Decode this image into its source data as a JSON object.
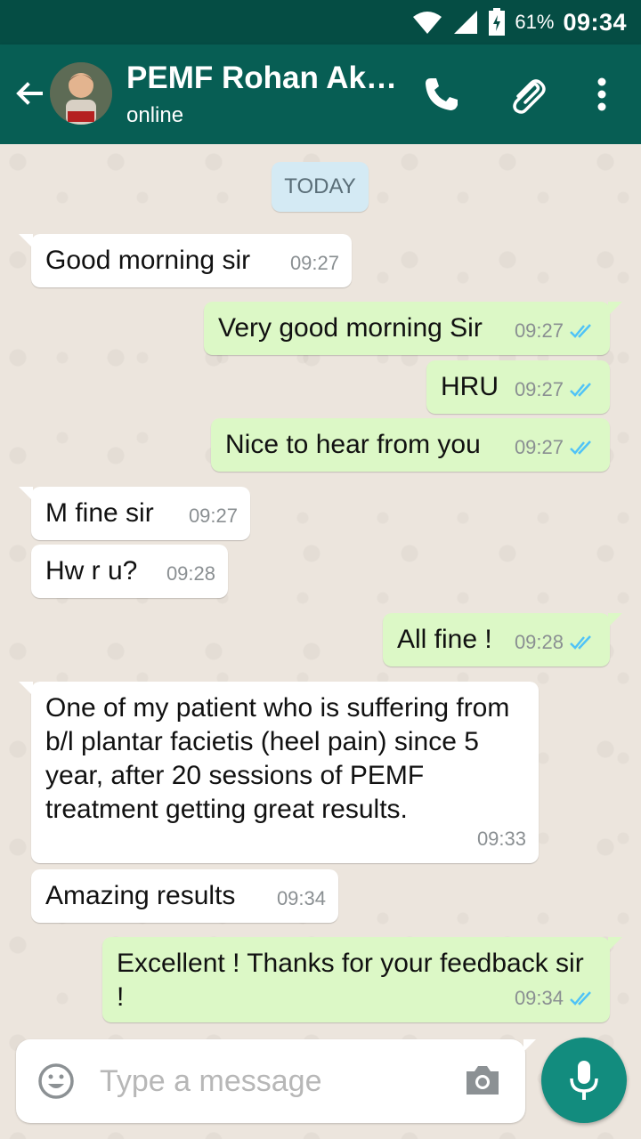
{
  "status_bar": {
    "battery": "61%",
    "time": "09:34"
  },
  "header": {
    "contact_name": "PEMF Rohan Ako...",
    "status": "online"
  },
  "date_label": "TODAY",
  "messages": [
    {
      "dir": "in",
      "text": "Good morning sir",
      "time": "09:27"
    },
    {
      "dir": "out",
      "text": "Very good morning Sir",
      "time": "09:27"
    },
    {
      "dir": "out",
      "text": "HRU",
      "time": "09:27"
    },
    {
      "dir": "out",
      "text": "Nice to hear from you",
      "time": "09:27"
    },
    {
      "dir": "in",
      "text": "M fine sir",
      "time": "09:27"
    },
    {
      "dir": "in",
      "text": "Hw r u?",
      "time": "09:28"
    },
    {
      "dir": "out",
      "text": "All fine !",
      "time": "09:28"
    },
    {
      "dir": "in",
      "text": "One of my patient who is suffering from b/l plantar facietis (heel pain) since 5 year, after 20 sessions of PEMF treatment getting great results.",
      "time": "09:33"
    },
    {
      "dir": "in",
      "text": "Amazing results",
      "time": "09:34"
    },
    {
      "dir": "out",
      "text": "Excellent ! Thanks for your feedback sir !",
      "time": "09:34"
    }
  ],
  "composer": {
    "placeholder": "Type a message"
  },
  "colors": {
    "header": "#075e54",
    "status_bar": "#054d44",
    "outgoing": "#dcf8c6",
    "incoming": "#ffffff",
    "read_ticks": "#4fc3f7",
    "fab": "#128c7e"
  },
  "icons": [
    "wifi-icon",
    "signal-icon",
    "battery-icon",
    "back-arrow-icon",
    "phone-icon",
    "attach-icon",
    "more-icon",
    "emoji-icon",
    "camera-icon",
    "mic-icon",
    "double-tick-icon"
  ]
}
